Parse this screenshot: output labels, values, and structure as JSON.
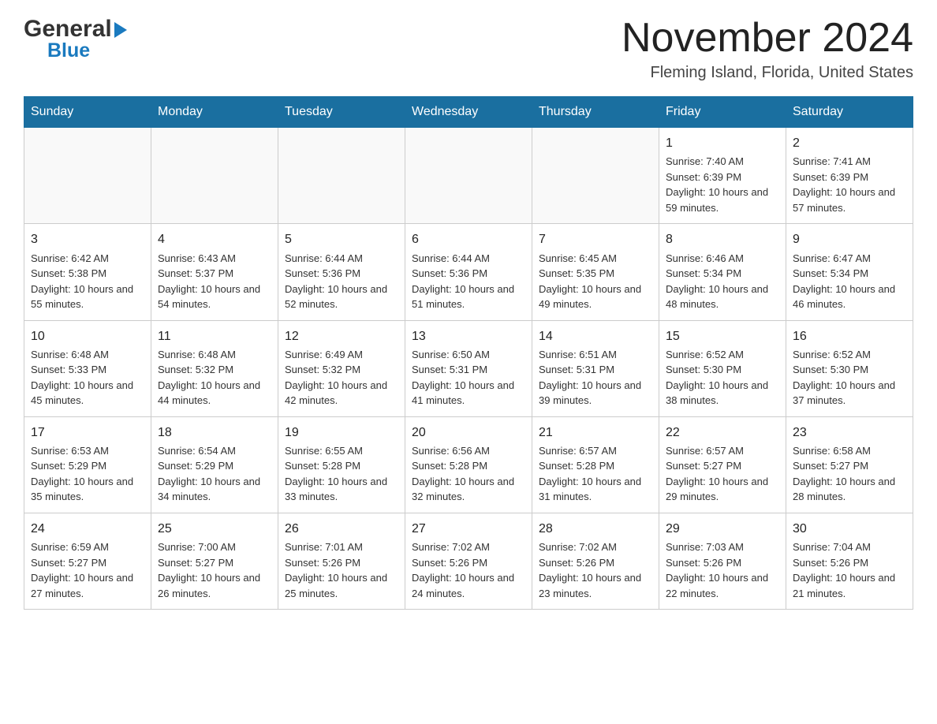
{
  "header": {
    "logo_general": "General",
    "logo_blue": "Blue",
    "title": "November 2024",
    "location": "Fleming Island, Florida, United States"
  },
  "calendar": {
    "days_of_week": [
      "Sunday",
      "Monday",
      "Tuesday",
      "Wednesday",
      "Thursday",
      "Friday",
      "Saturday"
    ],
    "weeks": [
      [
        {
          "day": "",
          "info": ""
        },
        {
          "day": "",
          "info": ""
        },
        {
          "day": "",
          "info": ""
        },
        {
          "day": "",
          "info": ""
        },
        {
          "day": "",
          "info": ""
        },
        {
          "day": "1",
          "info": "Sunrise: 7:40 AM\nSunset: 6:39 PM\nDaylight: 10 hours and 59 minutes."
        },
        {
          "day": "2",
          "info": "Sunrise: 7:41 AM\nSunset: 6:39 PM\nDaylight: 10 hours and 57 minutes."
        }
      ],
      [
        {
          "day": "3",
          "info": "Sunrise: 6:42 AM\nSunset: 5:38 PM\nDaylight: 10 hours and 55 minutes."
        },
        {
          "day": "4",
          "info": "Sunrise: 6:43 AM\nSunset: 5:37 PM\nDaylight: 10 hours and 54 minutes."
        },
        {
          "day": "5",
          "info": "Sunrise: 6:44 AM\nSunset: 5:36 PM\nDaylight: 10 hours and 52 minutes."
        },
        {
          "day": "6",
          "info": "Sunrise: 6:44 AM\nSunset: 5:36 PM\nDaylight: 10 hours and 51 minutes."
        },
        {
          "day": "7",
          "info": "Sunrise: 6:45 AM\nSunset: 5:35 PM\nDaylight: 10 hours and 49 minutes."
        },
        {
          "day": "8",
          "info": "Sunrise: 6:46 AM\nSunset: 5:34 PM\nDaylight: 10 hours and 48 minutes."
        },
        {
          "day": "9",
          "info": "Sunrise: 6:47 AM\nSunset: 5:34 PM\nDaylight: 10 hours and 46 minutes."
        }
      ],
      [
        {
          "day": "10",
          "info": "Sunrise: 6:48 AM\nSunset: 5:33 PM\nDaylight: 10 hours and 45 minutes."
        },
        {
          "day": "11",
          "info": "Sunrise: 6:48 AM\nSunset: 5:32 PM\nDaylight: 10 hours and 44 minutes."
        },
        {
          "day": "12",
          "info": "Sunrise: 6:49 AM\nSunset: 5:32 PM\nDaylight: 10 hours and 42 minutes."
        },
        {
          "day": "13",
          "info": "Sunrise: 6:50 AM\nSunset: 5:31 PM\nDaylight: 10 hours and 41 minutes."
        },
        {
          "day": "14",
          "info": "Sunrise: 6:51 AM\nSunset: 5:31 PM\nDaylight: 10 hours and 39 minutes."
        },
        {
          "day": "15",
          "info": "Sunrise: 6:52 AM\nSunset: 5:30 PM\nDaylight: 10 hours and 38 minutes."
        },
        {
          "day": "16",
          "info": "Sunrise: 6:52 AM\nSunset: 5:30 PM\nDaylight: 10 hours and 37 minutes."
        }
      ],
      [
        {
          "day": "17",
          "info": "Sunrise: 6:53 AM\nSunset: 5:29 PM\nDaylight: 10 hours and 35 minutes."
        },
        {
          "day": "18",
          "info": "Sunrise: 6:54 AM\nSunset: 5:29 PM\nDaylight: 10 hours and 34 minutes."
        },
        {
          "day": "19",
          "info": "Sunrise: 6:55 AM\nSunset: 5:28 PM\nDaylight: 10 hours and 33 minutes."
        },
        {
          "day": "20",
          "info": "Sunrise: 6:56 AM\nSunset: 5:28 PM\nDaylight: 10 hours and 32 minutes."
        },
        {
          "day": "21",
          "info": "Sunrise: 6:57 AM\nSunset: 5:28 PM\nDaylight: 10 hours and 31 minutes."
        },
        {
          "day": "22",
          "info": "Sunrise: 6:57 AM\nSunset: 5:27 PM\nDaylight: 10 hours and 29 minutes."
        },
        {
          "day": "23",
          "info": "Sunrise: 6:58 AM\nSunset: 5:27 PM\nDaylight: 10 hours and 28 minutes."
        }
      ],
      [
        {
          "day": "24",
          "info": "Sunrise: 6:59 AM\nSunset: 5:27 PM\nDaylight: 10 hours and 27 minutes."
        },
        {
          "day": "25",
          "info": "Sunrise: 7:00 AM\nSunset: 5:27 PM\nDaylight: 10 hours and 26 minutes."
        },
        {
          "day": "26",
          "info": "Sunrise: 7:01 AM\nSunset: 5:26 PM\nDaylight: 10 hours and 25 minutes."
        },
        {
          "day": "27",
          "info": "Sunrise: 7:02 AM\nSunset: 5:26 PM\nDaylight: 10 hours and 24 minutes."
        },
        {
          "day": "28",
          "info": "Sunrise: 7:02 AM\nSunset: 5:26 PM\nDaylight: 10 hours and 23 minutes."
        },
        {
          "day": "29",
          "info": "Sunrise: 7:03 AM\nSunset: 5:26 PM\nDaylight: 10 hours and 22 minutes."
        },
        {
          "day": "30",
          "info": "Sunrise: 7:04 AM\nSunset: 5:26 PM\nDaylight: 10 hours and 21 minutes."
        }
      ]
    ]
  }
}
